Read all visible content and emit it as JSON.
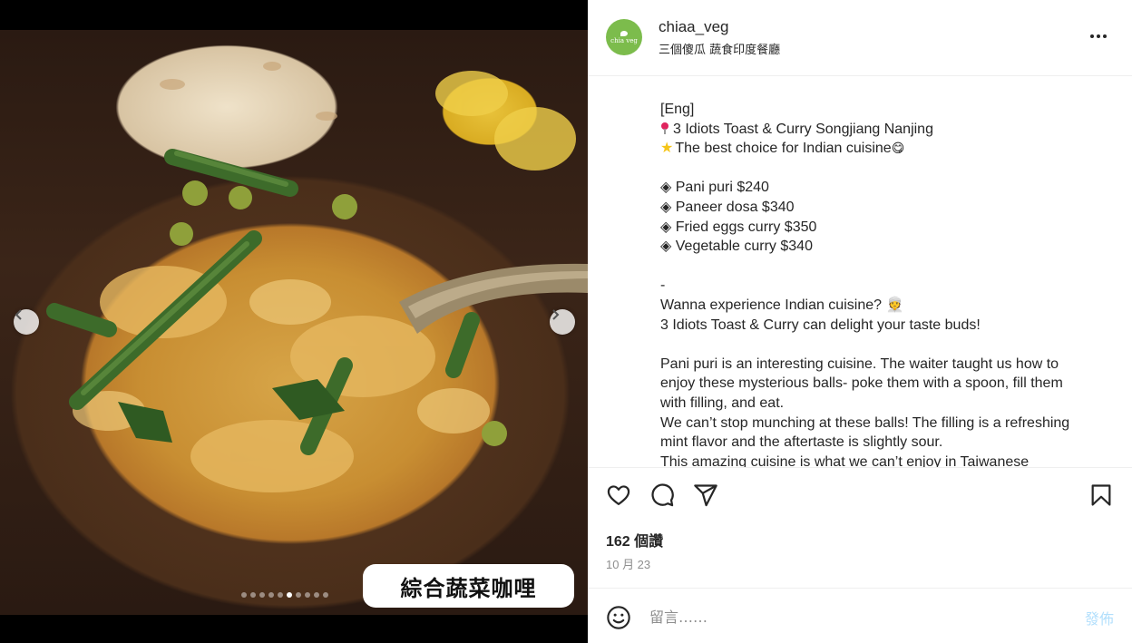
{
  "media": {
    "overlay_text": "綜合蔬菜咖哩",
    "carousel": {
      "total": 10,
      "active_index": 5
    }
  },
  "header": {
    "username": "chiaa_veg",
    "location": "三個傻瓜 蔬食印度餐廳",
    "avatar_text": "chia veg"
  },
  "caption": {
    "lines": [
      "[Eng]",
      "3 Idiots Toast & Curry Songjiang Nanjing",
      "The best choice for Indian cuisine",
      "",
      "◈ Pani puri $240",
      "◈ Paneer dosa $340",
      "◈ Fried eggs curry $350",
      "◈ Vegetable curry $340",
      "",
      "-",
      "Wanna experience Indian cuisine? 👳",
      "3 Idiots Toast & Curry can delight your taste buds!",
      "",
      "Pani puri is an interesting cuisine. The waiter taught us how to",
      "enjoy these mysterious balls- poke them with a spoon, fill them",
      "with filling, and eat.",
      "We can’t stop munching at these balls! The filling is a refreshing",
      "mint flavor and the aftertaste is slightly sour.",
      "This amazing cuisine is what we can’t enjoy in Taiwanese"
    ]
  },
  "stats": {
    "likes": "162 個讚",
    "date": "10 月 23"
  },
  "comment": {
    "placeholder": "留言……",
    "post_label": "發佈"
  },
  "icons": {
    "like": "heart-icon",
    "comment": "comment-icon",
    "share": "share-icon",
    "save": "bookmark-icon",
    "emoji": "emoji-icon",
    "more": "more-icon"
  }
}
